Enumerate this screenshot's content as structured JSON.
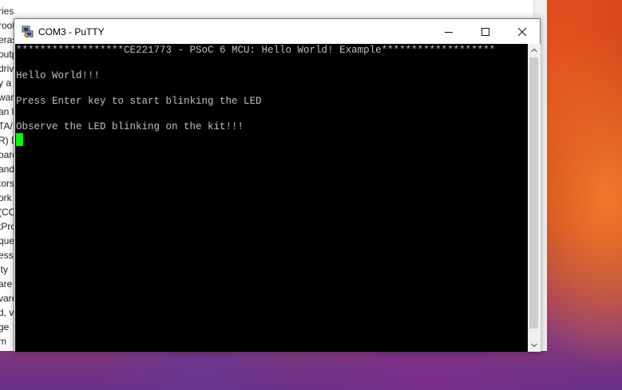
{
  "background_window": {
    "lines": [
      "ries",
      "root",
      "eras",
      "outp",
      "driv",
      "y a",
      "ware",
      "an l",
      "TA/",
      "R) D",
      "oard",
      "and",
      "tors",
      "ork",
      "(CO",
      "tPro",
      "que",
      "esso",
      "ity",
      "are",
      "vare",
      "d, v",
      "ge",
      "m"
    ]
  },
  "window": {
    "title": "COM3 - PuTTY",
    "minimize_label": "Minimize",
    "maximize_label": "Maximize",
    "close_label": "Close"
  },
  "terminal": {
    "lines": [
      "******************CE221773 - PSoC 6 MCU: Hello World! Example*******************",
      "",
      "Hello World!!!",
      "",
      "Press Enter key to start blinking the LED",
      "",
      "Observe the LED blinking on the kit!!!"
    ],
    "text_color": "#c0c0c0",
    "background_color": "#000000",
    "cursor_color": "#00ff00"
  },
  "icons": {
    "app": "putty-icon",
    "minimize": "minimize-icon",
    "maximize": "maximize-icon",
    "close": "close-icon",
    "scroll_up": "chevron-up-icon",
    "scroll_down": "chevron-down-icon"
  }
}
